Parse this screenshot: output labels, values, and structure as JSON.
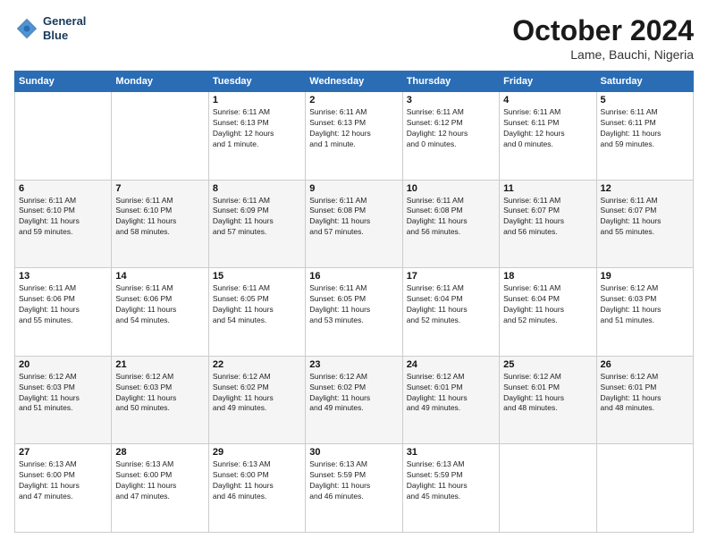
{
  "header": {
    "logo_line1": "General",
    "logo_line2": "Blue",
    "month_title": "October 2024",
    "location": "Lame, Bauchi, Nigeria"
  },
  "weekdays": [
    "Sunday",
    "Monday",
    "Tuesday",
    "Wednesday",
    "Thursday",
    "Friday",
    "Saturday"
  ],
  "weeks": [
    [
      {
        "day": "",
        "content": ""
      },
      {
        "day": "",
        "content": ""
      },
      {
        "day": "1",
        "content": "Sunrise: 6:11 AM\nSunset: 6:13 PM\nDaylight: 12 hours\nand 1 minute."
      },
      {
        "day": "2",
        "content": "Sunrise: 6:11 AM\nSunset: 6:13 PM\nDaylight: 12 hours\nand 1 minute."
      },
      {
        "day": "3",
        "content": "Sunrise: 6:11 AM\nSunset: 6:12 PM\nDaylight: 12 hours\nand 0 minutes."
      },
      {
        "day": "4",
        "content": "Sunrise: 6:11 AM\nSunset: 6:11 PM\nDaylight: 12 hours\nand 0 minutes."
      },
      {
        "day": "5",
        "content": "Sunrise: 6:11 AM\nSunset: 6:11 PM\nDaylight: 11 hours\nand 59 minutes."
      }
    ],
    [
      {
        "day": "6",
        "content": "Sunrise: 6:11 AM\nSunset: 6:10 PM\nDaylight: 11 hours\nand 59 minutes."
      },
      {
        "day": "7",
        "content": "Sunrise: 6:11 AM\nSunset: 6:10 PM\nDaylight: 11 hours\nand 58 minutes."
      },
      {
        "day": "8",
        "content": "Sunrise: 6:11 AM\nSunset: 6:09 PM\nDaylight: 11 hours\nand 57 minutes."
      },
      {
        "day": "9",
        "content": "Sunrise: 6:11 AM\nSunset: 6:08 PM\nDaylight: 11 hours\nand 57 minutes."
      },
      {
        "day": "10",
        "content": "Sunrise: 6:11 AM\nSunset: 6:08 PM\nDaylight: 11 hours\nand 56 minutes."
      },
      {
        "day": "11",
        "content": "Sunrise: 6:11 AM\nSunset: 6:07 PM\nDaylight: 11 hours\nand 56 minutes."
      },
      {
        "day": "12",
        "content": "Sunrise: 6:11 AM\nSunset: 6:07 PM\nDaylight: 11 hours\nand 55 minutes."
      }
    ],
    [
      {
        "day": "13",
        "content": "Sunrise: 6:11 AM\nSunset: 6:06 PM\nDaylight: 11 hours\nand 55 minutes."
      },
      {
        "day": "14",
        "content": "Sunrise: 6:11 AM\nSunset: 6:06 PM\nDaylight: 11 hours\nand 54 minutes."
      },
      {
        "day": "15",
        "content": "Sunrise: 6:11 AM\nSunset: 6:05 PM\nDaylight: 11 hours\nand 54 minutes."
      },
      {
        "day": "16",
        "content": "Sunrise: 6:11 AM\nSunset: 6:05 PM\nDaylight: 11 hours\nand 53 minutes."
      },
      {
        "day": "17",
        "content": "Sunrise: 6:11 AM\nSunset: 6:04 PM\nDaylight: 11 hours\nand 52 minutes."
      },
      {
        "day": "18",
        "content": "Sunrise: 6:11 AM\nSunset: 6:04 PM\nDaylight: 11 hours\nand 52 minutes."
      },
      {
        "day": "19",
        "content": "Sunrise: 6:12 AM\nSunset: 6:03 PM\nDaylight: 11 hours\nand 51 minutes."
      }
    ],
    [
      {
        "day": "20",
        "content": "Sunrise: 6:12 AM\nSunset: 6:03 PM\nDaylight: 11 hours\nand 51 minutes."
      },
      {
        "day": "21",
        "content": "Sunrise: 6:12 AM\nSunset: 6:03 PM\nDaylight: 11 hours\nand 50 minutes."
      },
      {
        "day": "22",
        "content": "Sunrise: 6:12 AM\nSunset: 6:02 PM\nDaylight: 11 hours\nand 49 minutes."
      },
      {
        "day": "23",
        "content": "Sunrise: 6:12 AM\nSunset: 6:02 PM\nDaylight: 11 hours\nand 49 minutes."
      },
      {
        "day": "24",
        "content": "Sunrise: 6:12 AM\nSunset: 6:01 PM\nDaylight: 11 hours\nand 49 minutes."
      },
      {
        "day": "25",
        "content": "Sunrise: 6:12 AM\nSunset: 6:01 PM\nDaylight: 11 hours\nand 48 minutes."
      },
      {
        "day": "26",
        "content": "Sunrise: 6:12 AM\nSunset: 6:01 PM\nDaylight: 11 hours\nand 48 minutes."
      }
    ],
    [
      {
        "day": "27",
        "content": "Sunrise: 6:13 AM\nSunset: 6:00 PM\nDaylight: 11 hours\nand 47 minutes."
      },
      {
        "day": "28",
        "content": "Sunrise: 6:13 AM\nSunset: 6:00 PM\nDaylight: 11 hours\nand 47 minutes."
      },
      {
        "day": "29",
        "content": "Sunrise: 6:13 AM\nSunset: 6:00 PM\nDaylight: 11 hours\nand 46 minutes."
      },
      {
        "day": "30",
        "content": "Sunrise: 6:13 AM\nSunset: 5:59 PM\nDaylight: 11 hours\nand 46 minutes."
      },
      {
        "day": "31",
        "content": "Sunrise: 6:13 AM\nSunset: 5:59 PM\nDaylight: 11 hours\nand 45 minutes."
      },
      {
        "day": "",
        "content": ""
      },
      {
        "day": "",
        "content": ""
      }
    ]
  ]
}
